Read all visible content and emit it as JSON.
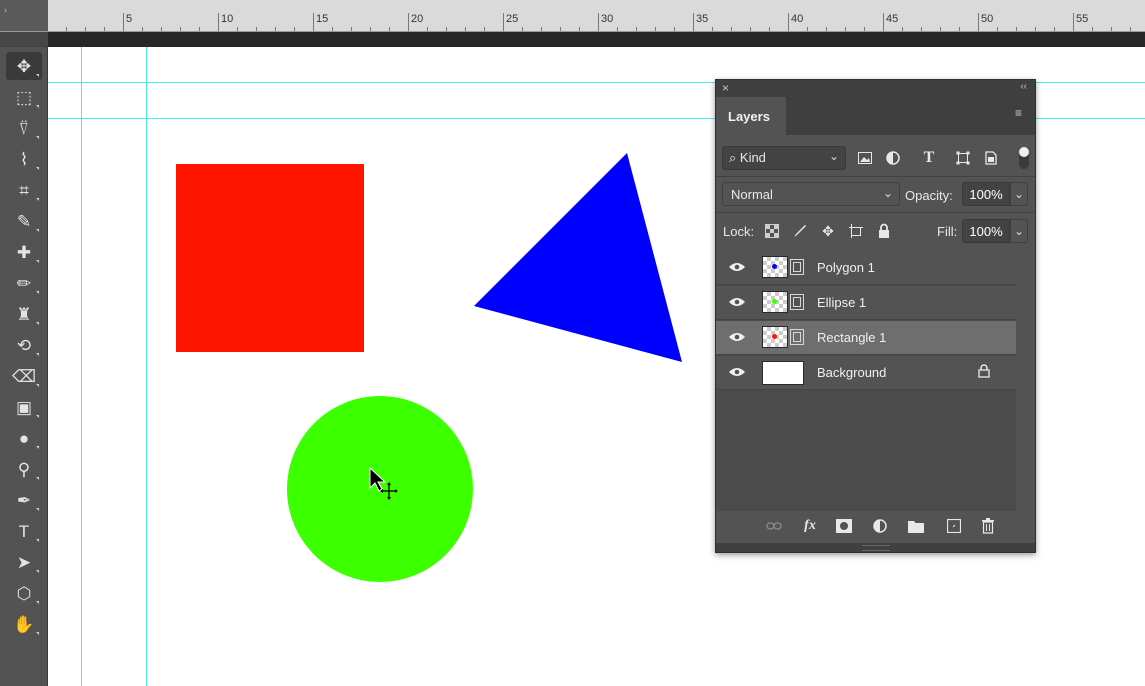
{
  "ruler": {
    "numbers": [
      "5",
      "10",
      "15",
      "20",
      "25",
      "30",
      "35",
      "40",
      "45",
      "50",
      "55"
    ]
  },
  "tools": [
    {
      "name": "move-tool",
      "glyph": "✥",
      "active": true
    },
    {
      "name": "marquee-tool",
      "glyph": "⬚"
    },
    {
      "name": "lasso-tool",
      "glyph": "⍢"
    },
    {
      "name": "quick-select-tool",
      "glyph": "⌇"
    },
    {
      "name": "crop-tool",
      "glyph": "⌗"
    },
    {
      "name": "eyedropper-tool",
      "glyph": "✎"
    },
    {
      "name": "healing-brush-tool",
      "glyph": "✚"
    },
    {
      "name": "brush-tool",
      "glyph": "✏"
    },
    {
      "name": "stamp-tool",
      "glyph": "♜"
    },
    {
      "name": "history-brush-tool",
      "glyph": "⟲"
    },
    {
      "name": "eraser-tool",
      "glyph": "⌫"
    },
    {
      "name": "gradient-tool",
      "glyph": "▣"
    },
    {
      "name": "blur-tool",
      "glyph": "●"
    },
    {
      "name": "dodge-tool",
      "glyph": "⚲"
    },
    {
      "name": "pen-tool",
      "glyph": "✒"
    },
    {
      "name": "type-tool",
      "glyph": "T"
    },
    {
      "name": "path-select-tool",
      "glyph": "➤"
    },
    {
      "name": "shape-tool",
      "glyph": "⬡"
    },
    {
      "name": "hand-tool",
      "glyph": "✋"
    }
  ],
  "canvas": {
    "shapes": {
      "rectangle_color": "#ff1400",
      "triangle_color": "#0000ff",
      "ellipse_color": "#3cff00"
    },
    "guide_color": "#4fe8e8"
  },
  "panel": {
    "close_glyph": "×",
    "collapse_glyph": "‹‹",
    "tab_label": "Layers",
    "menu_glyph": "≡",
    "filter": {
      "kind_label": "⌕ Kind",
      "caret": "⌄"
    },
    "blend": {
      "mode": "Normal",
      "caret": "⌄",
      "opacity_label": "Opacity:",
      "opacity_value": "100%"
    },
    "lock": {
      "label": "Lock:",
      "fill_label": "Fill:",
      "fill_value": "100%"
    },
    "layers": [
      {
        "name": "Polygon 1",
        "dot_color": "#0000ff",
        "type": "shape",
        "selected": false
      },
      {
        "name": "Ellipse 1",
        "dot_color": "#3cff00",
        "type": "shape",
        "selected": false
      },
      {
        "name": "Rectangle 1",
        "dot_color": "#ff1400",
        "type": "shape",
        "selected": true
      },
      {
        "name": "Background",
        "type": "background",
        "locked": true,
        "selected": false
      }
    ]
  }
}
